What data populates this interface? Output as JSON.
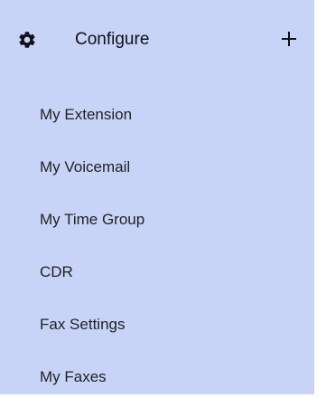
{
  "header": {
    "label": "Configure",
    "icon": "gear-icon",
    "expand_icon": "plus-icon"
  },
  "menu": {
    "items": [
      {
        "label": "My Extension"
      },
      {
        "label": "My Voicemail"
      },
      {
        "label": "My Time Group"
      },
      {
        "label": "CDR"
      },
      {
        "label": "Fax Settings"
      },
      {
        "label": "My Faxes"
      }
    ]
  },
  "colors": {
    "panel_background": "#c7d4f7",
    "text": "#222222"
  }
}
